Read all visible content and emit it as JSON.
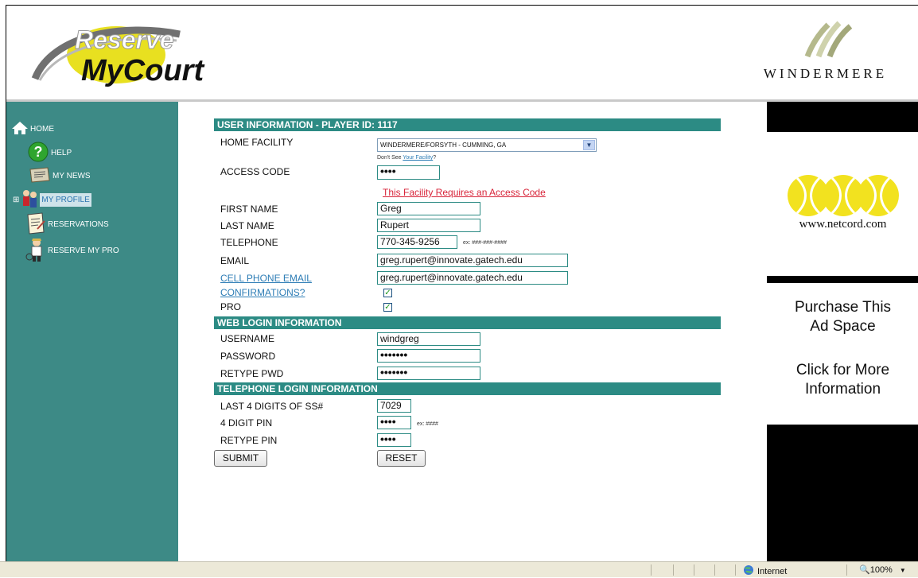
{
  "header": {
    "logo_line1": "Reserve",
    "logo_line2": "MyCourt",
    "brand": "WINDERMERE"
  },
  "sidebar": {
    "items": [
      {
        "label": "HOME",
        "icon": "home-icon"
      },
      {
        "label": "HELP",
        "icon": "help-icon"
      },
      {
        "label": "MY NEWS",
        "icon": "news-icon"
      },
      {
        "label": "MY PROFILE",
        "icon": "profile-icon",
        "selected": true
      },
      {
        "label": "RESERVATIONS",
        "icon": "reservations-icon"
      },
      {
        "label": "RESERVE MY PRO",
        "icon": "pro-icon"
      }
    ]
  },
  "form": {
    "section_user": "USER INFORMATION - PLAYER ID: 1117",
    "home_facility_label": "HOME FACILITY",
    "home_facility_value": "WINDERMERE/FORSYTH - CUMMING, GA",
    "dont_see_prefix": "Don't See ",
    "dont_see_link": "Your Facility",
    "dont_see_suffix": "?",
    "access_code_label": "ACCESS CODE",
    "access_code_value": "••••",
    "access_warning": "This Facility Requires an Access Code",
    "first_name_label": "FIRST NAME",
    "first_name_value": "Greg",
    "last_name_label": "LAST NAME",
    "last_name_value": "Rupert",
    "telephone_label": "TELEPHONE",
    "telephone_value": "770-345-9256",
    "telephone_hint": "ex: ###-###-####",
    "email_label": "EMAIL",
    "email_value": "greg.rupert@innovate.gatech.edu",
    "cell_email_label": "CELL PHONE EMAIL",
    "cell_email_value": "greg.rupert@innovate.gatech.edu",
    "confirmations_label": "CONFIRMATIONS?",
    "confirmations_checked": true,
    "pro_label": "PRO",
    "pro_checked": true,
    "section_web": "WEB LOGIN INFORMATION",
    "username_label": "USERNAME",
    "username_value": "windgreg",
    "password_label": "PASSWORD",
    "password_value": "•••••••",
    "retype_pwd_label": "RETYPE PWD",
    "retype_pwd_value": "•••••••",
    "section_phone": "TELEPHONE LOGIN INFORMATION",
    "ss_label": "LAST 4 DIGITS OF SS#",
    "ss_value": "7029",
    "pin_label": "4 DIGIT PIN",
    "pin_value": "••••",
    "pin_hint": "ex: ####",
    "retype_pin_label": "RETYPE PIN",
    "retype_pin_value": "••••",
    "submit_label": "SUBMIT",
    "reset_label": "RESET"
  },
  "ads": {
    "netcord_url": "www.netcord.com",
    "purchase_line1": "Purchase This",
    "purchase_line2": "Ad Space",
    "click_line1": "Click for More",
    "click_line2": "Information"
  },
  "statusbar": {
    "zone": "Internet",
    "zoom": "100%"
  },
  "colors": {
    "sidebar": "#3d8a86",
    "section_header": "#2c8b84",
    "warning": "#d8263b",
    "link": "#2c7cb5",
    "tennis_ball": "#f2e21f"
  }
}
